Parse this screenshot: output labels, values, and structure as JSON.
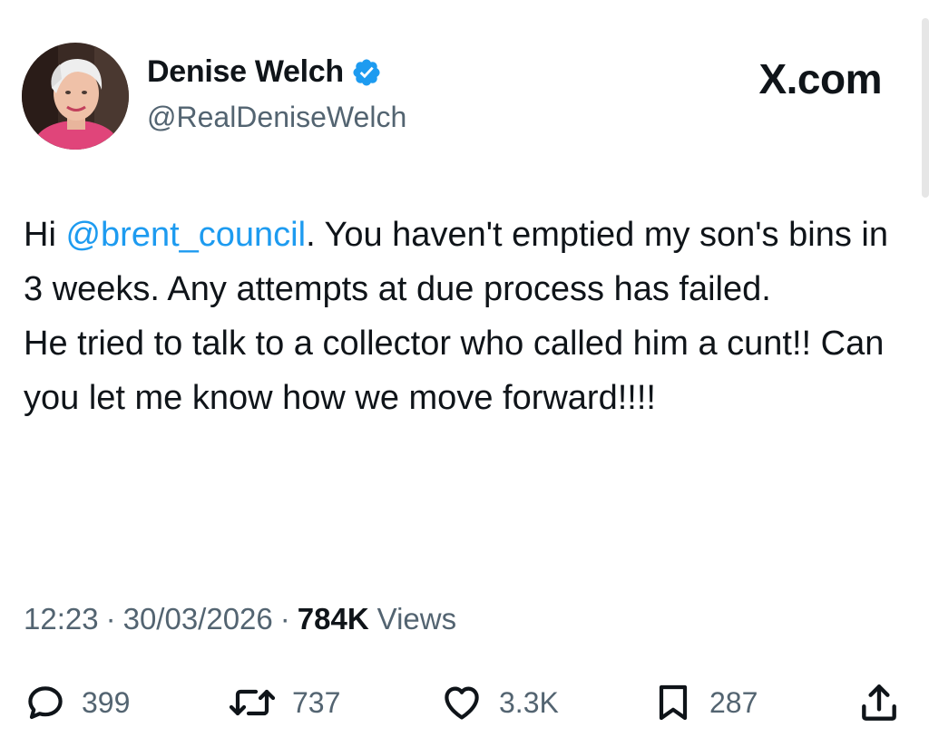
{
  "author": {
    "name": "Denise Welch",
    "handle": "@RealDeniseWelch",
    "verified": true,
    "avatar_icon": "profile-photo"
  },
  "brand": {
    "label": "X.com"
  },
  "tweet": {
    "greeting": "Hi ",
    "mention": "@brent_council",
    "text_after_mention": ". You haven't emptied my son's bins in 3 weeks. Any attempts at due process has failed.",
    "text_line2": "He tried to talk to a collector who called him a cunt!! Can you let me know how we move forward!!!!"
  },
  "meta": {
    "time": "12:23",
    "date": "30/03/2026",
    "views_count": "784K",
    "views_label": "Views"
  },
  "actions": {
    "replies": "399",
    "reposts": "737",
    "likes": "3.3K",
    "bookmarks": "287"
  },
  "colors": {
    "link": "#1d9bf0",
    "text": "#0f1419",
    "secondary": "#536471",
    "verified": "#1d9bf0"
  }
}
